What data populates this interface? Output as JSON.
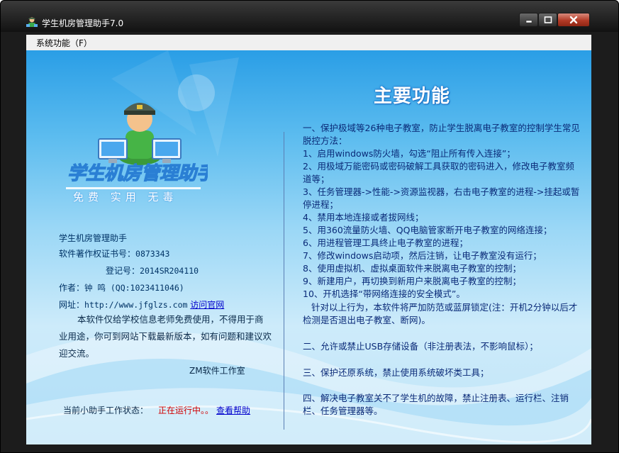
{
  "window": {
    "title": "学生机房管理助手7.0"
  },
  "menu": {
    "system": "系统功能（F）"
  },
  "logo": {
    "title": "学生机房管理助手",
    "slogan": "免费  实用  无毒"
  },
  "info": {
    "app_name": "学生机房管理助手",
    "copyright_label": "软件著作权证书号：",
    "copyright_no": "0873343",
    "reg_label": "登记号：",
    "reg_no": "2014SR204110",
    "author_label": "作者：",
    "author": "钟 鸣 (QQ:1023411046)",
    "site_label": "网址：",
    "site_url": "http://www.jfglzs.com",
    "site_link": "访问官网",
    "notice": "本软件仅给学校信息老师免费使用，不得用于商业用途，你可到网站下载最新版本，如有问题和建议欢迎交流。",
    "studio": "ZM软件工作室"
  },
  "status": {
    "label": "当前小助手工作状态：",
    "value": "正在运行中。。",
    "help": "查看帮助"
  },
  "features": {
    "title": "主要功能",
    "sec1_head": "一、保护极域等26种电子教室，防止学生脱离电子教室的控制学生常见脱控方法：",
    "items": [
      "1、启用windows防火墙，勾选“阻止所有传入连接”；",
      "2、用极域万能密码或密码破解工具获取的密码进入，修改电子教室频道等；",
      "3、任务管理器->性能->资源监视器，右击电子教室的进程->挂起或暂停进程；",
      "4、禁用本地连接或者拔网线；",
      "5、用360流量防火墙、QQ电脑管家断开电子教室的网络连接；",
      "6、用进程管理工具终止电子教室的进程；",
      "7、修改windows启动项，然后注销，让电子教室没有运行；",
      "8、使用虚拟机、虚拟桌面软件来脱离电子教室的控制；",
      "9、新建用户，再切换到新用户来脱离电子教室的控制；",
      "10、开机选择“带网络连接的安全模式”。"
    ],
    "sec1_tail": "针对以上行为，本软件将严加防范或蓝屏锁定(注：开机2分钟以后才检测是否退出电子教室、断网)。",
    "sec2": "二、允许或禁止USB存储设备（非注册表法，不影响鼠标）；",
    "sec3": "三、保护还原系统，禁止使用系统破坏类工具；",
    "sec4": "四、解决电子教室关不了学生机的故障，禁止注册表、运行栏、注销栏、任务管理器等。"
  }
}
